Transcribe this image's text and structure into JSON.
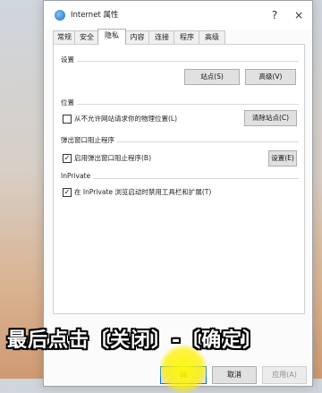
{
  "window": {
    "title": "Internet 属性",
    "help_label": "?",
    "close_label": "×"
  },
  "tabs": [
    {
      "label": "常规"
    },
    {
      "label": "安全"
    },
    {
      "label": "隐私",
      "active": true
    },
    {
      "label": "内容"
    },
    {
      "label": "连接"
    },
    {
      "label": "程序"
    },
    {
      "label": "高级"
    }
  ],
  "settings": {
    "group_label": "设置",
    "sites_button": "站点(S)",
    "advanced_button": "高级(V)"
  },
  "location": {
    "group_label": "位置",
    "checkbox_label": "从不允许网站请求你的物理位置(L)",
    "checked": false,
    "clear_button": "清除站点(C)"
  },
  "popup": {
    "group_label": "弹出窗口阻止程序",
    "checkbox_label": "启用弹出窗口阻止程序(B)",
    "checked": true,
    "settings_button": "设置(E)"
  },
  "inprivate": {
    "group_label": "InPrivate",
    "checkbox_label": "在 InPrivate 浏览启动时禁用工具栏和扩展(T)",
    "checked": true
  },
  "bottom_buttons": {
    "ok": "确",
    "cancel": "取消",
    "apply": "应用(A)"
  },
  "caption": "最后点击〔关闭〕-〔确定〕",
  "colors": {
    "highlight": "#fff200",
    "focus_border": "#0078d7"
  },
  "icons": {
    "title_icon": "internet-globe-icon",
    "checkbox_mark": "✓"
  }
}
